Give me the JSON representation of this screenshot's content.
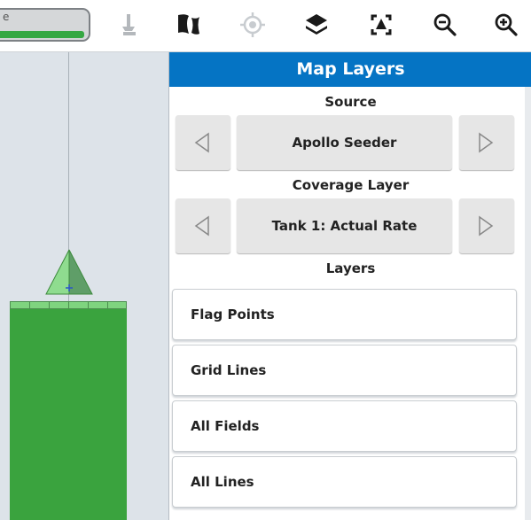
{
  "toolbar": {
    "status_text": "e",
    "status_progress": 0.95,
    "icons": [
      "touch-pointer-icon",
      "field-map-icon",
      "target-icon",
      "layers-icon",
      "fit-view-icon",
      "zoom-out-icon",
      "zoom-in-icon"
    ]
  },
  "colors": {
    "header_blue": "#0574c4",
    "coverage_green": "#3aa33e",
    "boom_green": "#7fd47f",
    "map_background": "#dde3e9"
  },
  "panel": {
    "title": "Map Layers",
    "source": {
      "label": "Source",
      "value": "Apollo Seeder"
    },
    "coverage": {
      "label": "Coverage Layer",
      "value": "Tank 1: Actual Rate"
    },
    "layers": {
      "label": "Layers",
      "items": [
        "Flag Points",
        "Grid Lines",
        "All Fields",
        "All Lines"
      ]
    }
  }
}
